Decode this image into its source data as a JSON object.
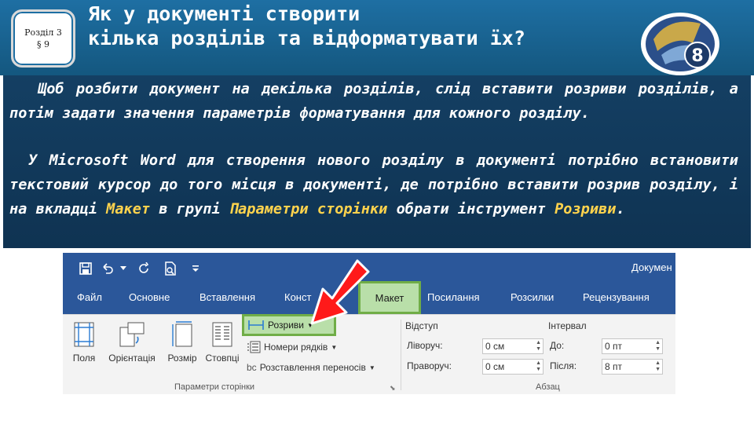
{
  "header": {
    "badge_line1": "Розділ 3",
    "badge_line2": "§ 9",
    "title_line1": "Як у документі створити",
    "title_line2": "кілька розділів та відформатувати їх?",
    "grade_number": "8"
  },
  "text": {
    "p1": "Щоб розбити документ на декілька розділів, слід вставити розриви розділів, а потім задати значення параметрів форматування для кожного розділу.",
    "p2_a": "У Microsoft Word для створення нового розділу в документі потрібно встановити текстовий курсор до того місця в документі, де потрібно вставити розрив розділу, і на вкладці ",
    "p2_tab": "Макет",
    "p2_b": " в групі ",
    "p2_group": "Параметри сторінки",
    "p2_c": " обрати інструмент ",
    "p2_tool": "Розриви",
    "p2_end": ".",
    "highlight_color": "#ffd34d"
  },
  "word": {
    "doc_title": "Докумен",
    "tabs": [
      "Файл",
      "Основне",
      "Вставлення",
      "Конст",
      "Макет",
      "Посилання",
      "Розсилки",
      "Рецензування"
    ],
    "active_tab": "Макет",
    "buttons": {
      "fields": "Поля",
      "orientation": "Орієнтація",
      "size": "Розмір",
      "columns": "Стовпці",
      "breaks": "Розриви",
      "line_numbers": "Номери рядків",
      "hyphenation": "Розставлення переносів"
    },
    "group_page_setup": "Параметри сторінки",
    "indent": {
      "header": "Відступ",
      "left_label": "Ліворуч:",
      "left_value": "0 см",
      "right_label": "Праворуч:",
      "right_value": "0 см"
    },
    "spacing": {
      "header": "Інтервал",
      "before_label": "До:",
      "before_value": "0 пт",
      "after_label": "Після:",
      "after_value": "8 пт"
    },
    "group_paragraph": "Абзац",
    "accent_color": "#2b579a",
    "highlight_green": "#70ad47"
  }
}
